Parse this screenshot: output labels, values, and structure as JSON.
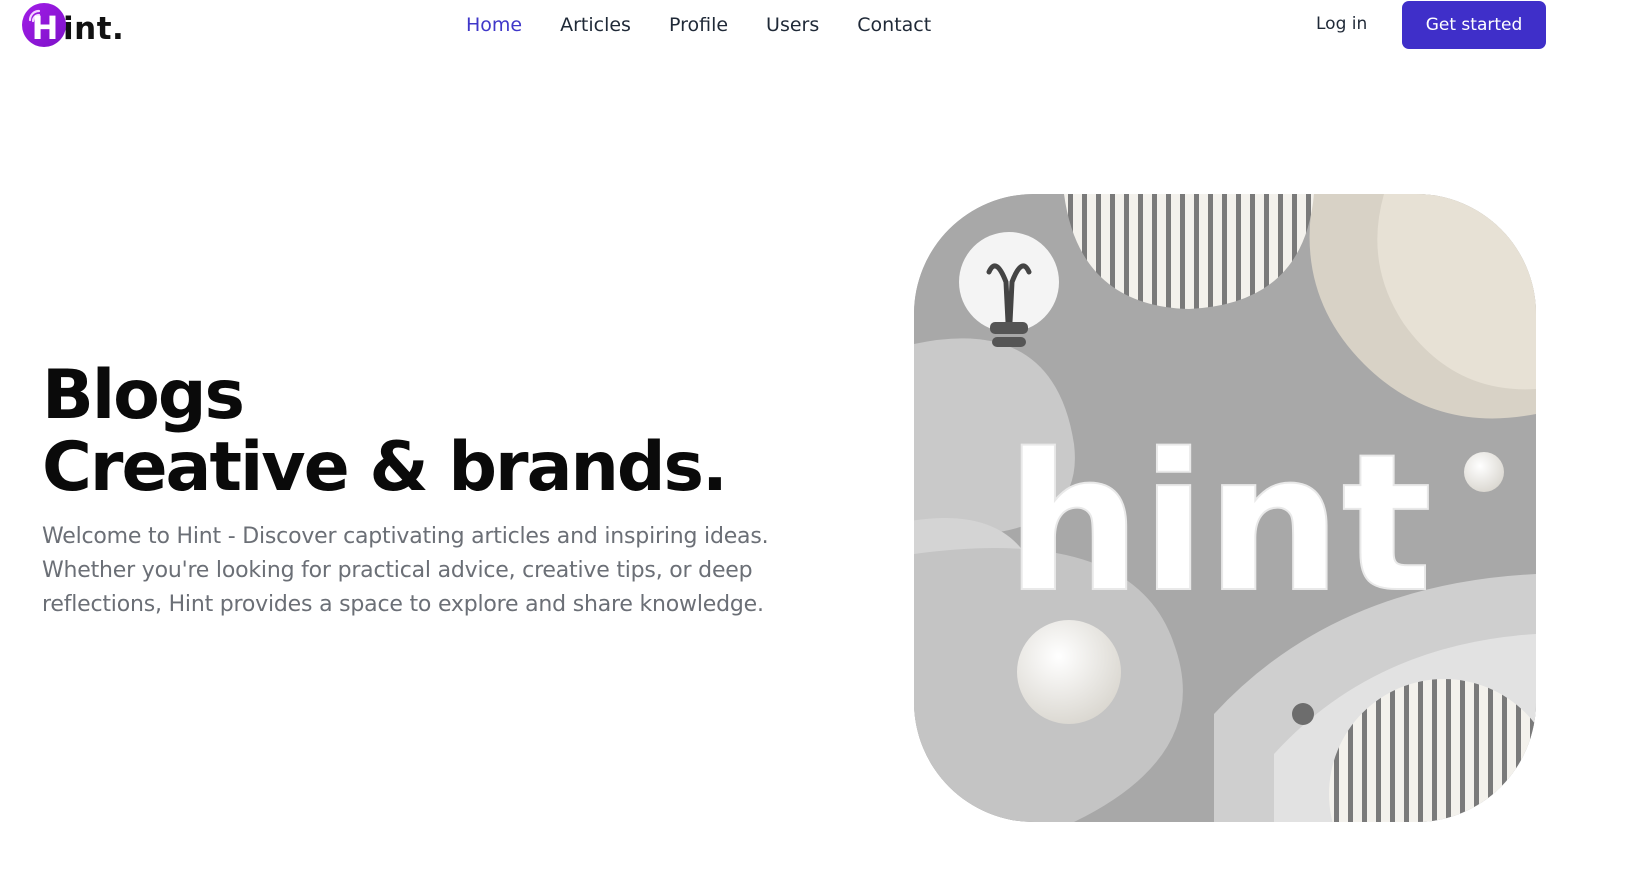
{
  "brand": {
    "logo_letter": "H",
    "logo_rest": "int.",
    "accent": "#9b1ee0"
  },
  "nav": {
    "links": [
      {
        "label": "Home",
        "active": true
      },
      {
        "label": "Articles",
        "active": false
      },
      {
        "label": "Profile",
        "active": false
      },
      {
        "label": "Users",
        "active": false
      },
      {
        "label": "Contact",
        "active": false
      }
    ],
    "active_color": "#3f37c9"
  },
  "header": {
    "login_label": "Log in",
    "cta_label": "Get started",
    "cta_color": "#3f2fc9"
  },
  "hero": {
    "title_line1": "Blogs",
    "title_line2": "Creative & brands.",
    "text_line1": "Welcome to Hint - Discover captivating articles and inspiring ideas.",
    "text_line2": "Whether you're looking for practical advice, creative tips, or deep",
    "text_line3": "reflections, Hint provides a space to explore and share knowledge.",
    "image_word": "hint",
    "image_icon": "lightbulb-icon"
  }
}
